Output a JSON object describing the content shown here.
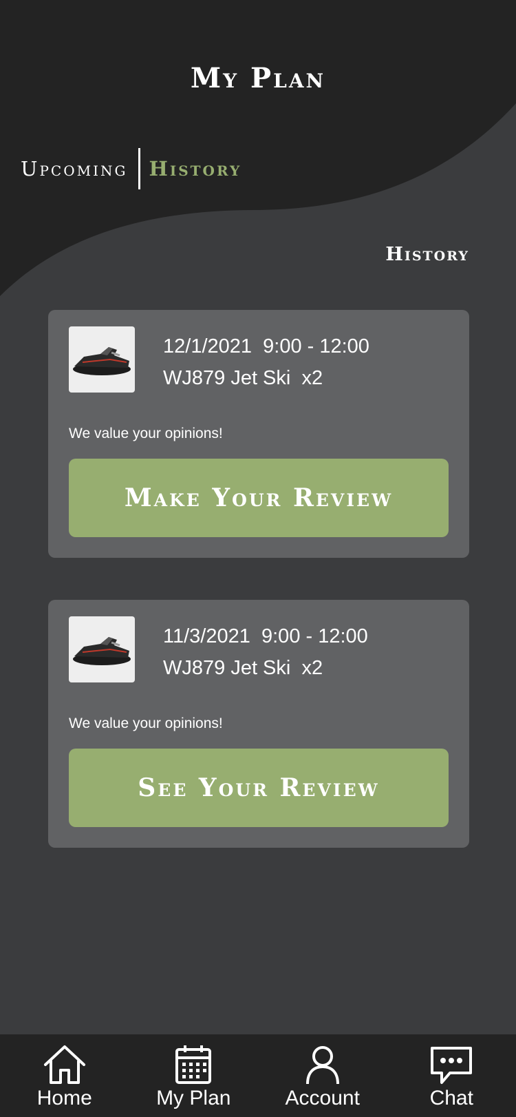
{
  "header": {
    "title": "My Plan"
  },
  "tabs": [
    {
      "label": "Upcoming",
      "active": false
    },
    {
      "label": "History",
      "active": true
    }
  ],
  "section": {
    "title": "History"
  },
  "bookings": [
    {
      "date": "12/1/2021",
      "time": "9:00 - 12:00",
      "item": "WJ879 Jet Ski",
      "quantity": "x2",
      "note": "We value your opinions!",
      "button_label": "Make Your Review",
      "image_icon": "jet-ski-image"
    },
    {
      "date": "11/3/2021",
      "time": "9:00 - 12:00",
      "item": "WJ879 Jet Ski",
      "quantity": "x2",
      "note": "We value your opinions!",
      "button_label": "See Your Review",
      "image_icon": "jet-ski-image"
    }
  ],
  "bottom_nav": [
    {
      "label": "Home",
      "icon": "home-icon"
    },
    {
      "label": "My Plan",
      "icon": "calendar-icon"
    },
    {
      "label": "Account",
      "icon": "user-icon"
    },
    {
      "label": "Chat",
      "icon": "chat-icon"
    }
  ],
  "colors": {
    "background": "#3b3c3e",
    "header_dark": "#232323",
    "card": "#616264",
    "accent_green": "#97ae70"
  }
}
